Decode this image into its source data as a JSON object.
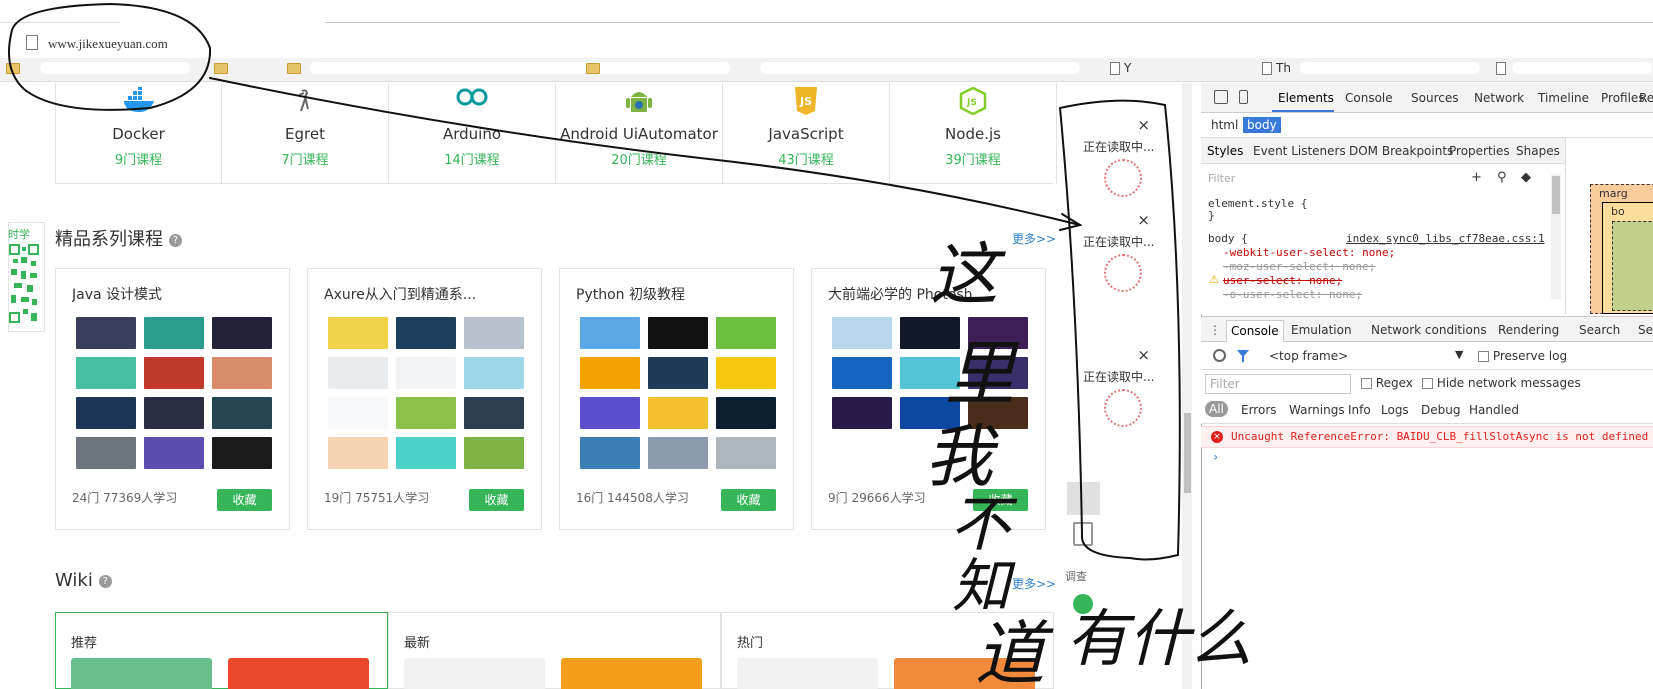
{
  "browser": {
    "url": "www.jikexueyuan.com",
    "bookmarks": [
      "Th",
      "Y"
    ]
  },
  "categories": [
    {
      "name": "Docker",
      "count": "9门课程",
      "icon": "docker-whale-icon"
    },
    {
      "name": "Egret",
      "count": "7门课程",
      "icon": "egret-bird-icon"
    },
    {
      "name": "Arduino",
      "count": "14门课程",
      "icon": "arduino-infinity-icon"
    },
    {
      "name": "Android UiAutomator",
      "count": "20门课程",
      "icon": "android-robot-icon"
    },
    {
      "name": "JavaScript",
      "count": "43门课程",
      "icon": "javascript-shield-icon"
    },
    {
      "name": "Node.js",
      "count": "39门课程",
      "icon": "nodejs-hexagon-icon"
    }
  ],
  "series_section": {
    "title": "精品系列课程",
    "more": "更多>>",
    "cards": [
      {
        "title": "Java 设计模式",
        "meta": "24门 77369人学习",
        "fav": "收藏"
      },
      {
        "title": "Axure从入门到精通系...",
        "meta": "19门 75751人学习",
        "fav": "收藏"
      },
      {
        "title": "Python 初级教程",
        "meta": "16门 144508人学习",
        "fav": "收藏"
      },
      {
        "title": "大前端必学的 Photosh...",
        "meta": "9门 29666人学习",
        "fav": "收藏"
      }
    ]
  },
  "side_qr": {
    "label": "时学"
  },
  "wiki": {
    "title": "Wiki",
    "more": "更多>>",
    "tabs": [
      "推荐",
      "最新",
      "热门"
    ]
  },
  "ad_panel": {
    "items": [
      {
        "text": "正在读取中...",
        "close": "×"
      },
      {
        "text": "正在读取中...",
        "close": "×"
      },
      {
        "text": "正在读取中...",
        "close": "×"
      }
    ]
  },
  "float_tools": {
    "survey": "调查"
  },
  "devtools": {
    "tabs": [
      "Elements",
      "Console",
      "Sources",
      "Network",
      "Timeline",
      "Profiles",
      "Re"
    ],
    "active_tab": "Elements",
    "breadcrumb": [
      "html",
      "body"
    ],
    "styles_tabs": [
      "Styles",
      "Event Listeners",
      "DOM Breakpoints",
      "Properties",
      "Shapes"
    ],
    "styles_filter_placeholder": "Filter",
    "styles_toolbar": [
      "+",
      "⚲",
      "◆"
    ],
    "css": {
      "element_style": "element.style {",
      "element_close": "}",
      "body_selector": "body {",
      "source": "index_sync0_libs_cf78eae.css:1",
      "props": [
        "-webkit-user-select: none;",
        "-moz-user-select: none;",
        "user-select: none;",
        "-o-user-select: none;"
      ]
    },
    "box_model": [
      "marg",
      "bo"
    ],
    "drawer_tabs": [
      "Console",
      "Emulation",
      "Network conditions",
      "Rendering",
      "Search",
      "Se"
    ],
    "context": "<top frame>",
    "preserve_log": "Preserve log",
    "filter_placeholder": "Filter",
    "regex": "Regex",
    "hide_network": "Hide network messages",
    "levels": [
      "All",
      "Errors",
      "Warnings",
      "Info",
      "Logs",
      "Debug",
      "Handled"
    ],
    "error": "Uncaught ReferenceError: BAIDU_CLB_fillSlotAsync is not defined",
    "prompt": "›"
  },
  "annotation": {
    "handwriting": [
      "这",
      "里",
      "我",
      "不",
      "知",
      "道",
      "有什么"
    ],
    "ink_color": "#111111"
  },
  "colors": {
    "accent_green": "#35b558",
    "link_blue": "#2f80c9",
    "devtools_blue": "#3879d9",
    "error_red": "#e0201c"
  }
}
